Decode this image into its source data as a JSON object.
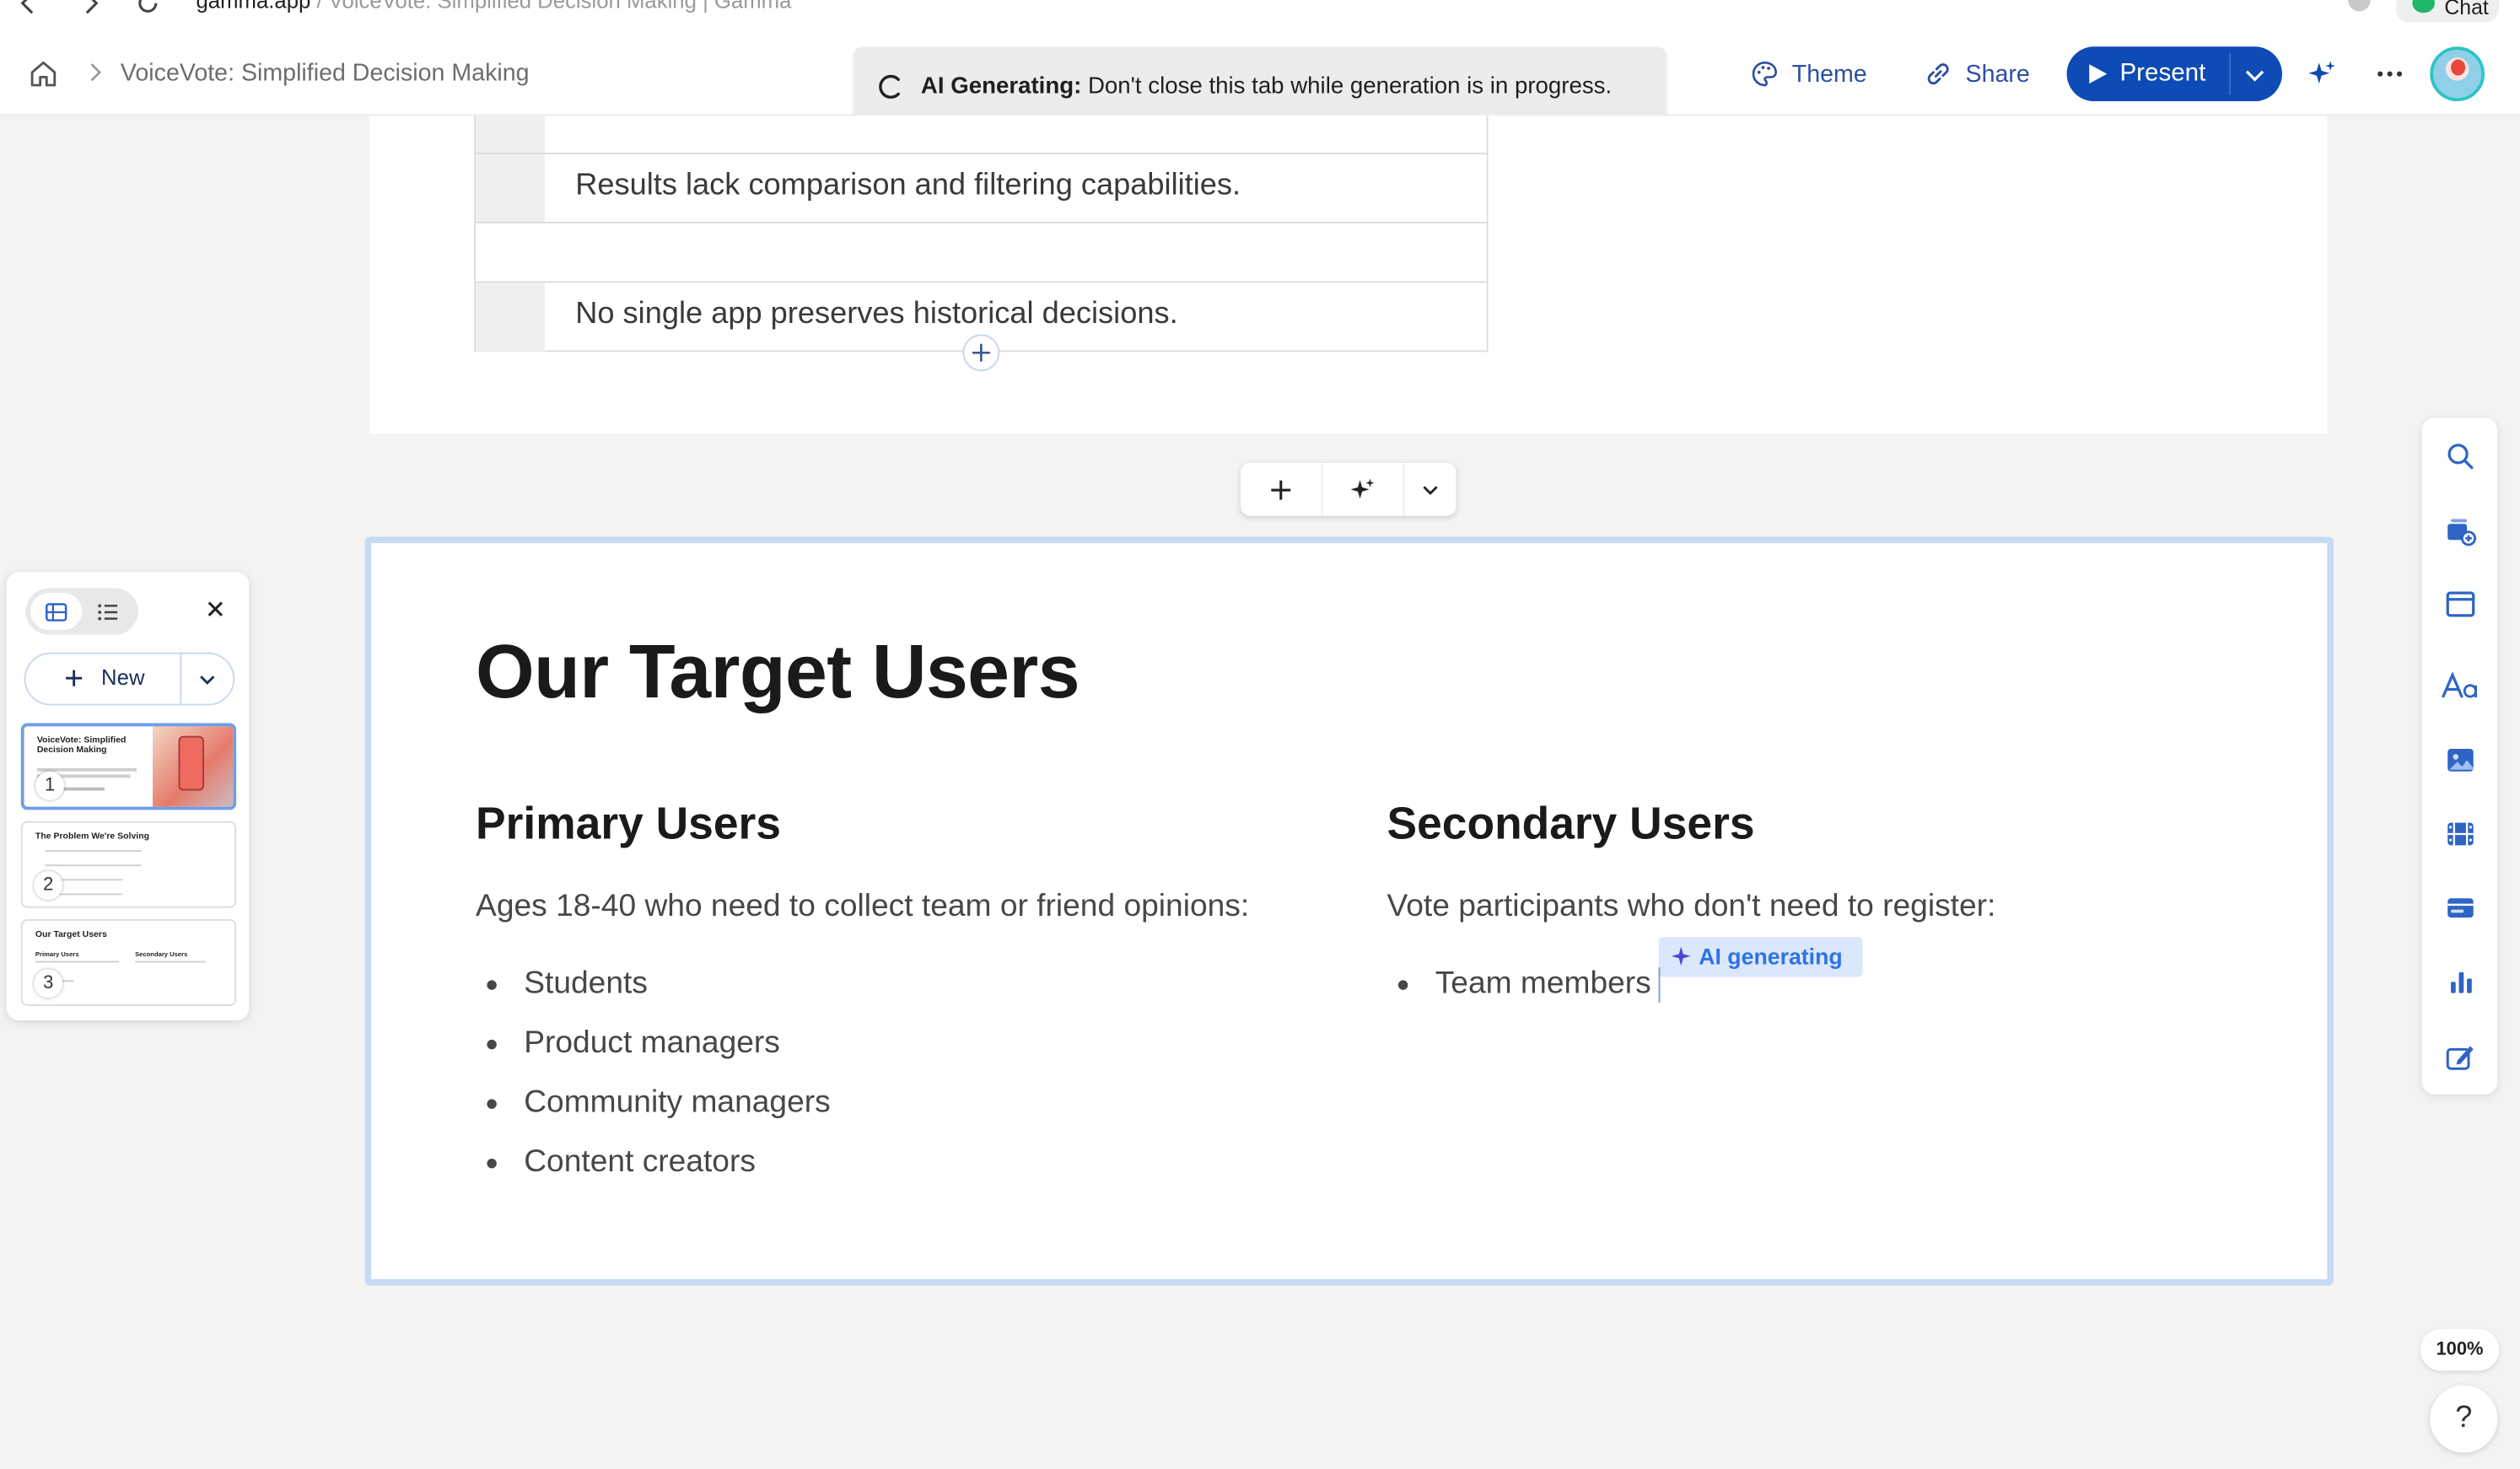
{
  "browser": {
    "url_host": "gamma.app",
    "url_rest": " / VoiceVote: Simplified Decision Making | Gamma",
    "chat_label": "Chat"
  },
  "topbar": {
    "doc_title": "VoiceVote: Simplified Decision Making",
    "ai_banner_bold": "AI Generating:",
    "ai_banner_text": " Don't close this tab while generation is in progress.",
    "theme_label": "Theme",
    "share_label": "Share",
    "present_label": "Present"
  },
  "previous_card": {
    "rows": [
      "",
      "Results lack comparison and filtering capabilities.",
      "",
      "No single app preserves historical decisions."
    ]
  },
  "current_card": {
    "title": "Our Target Users",
    "primary": {
      "heading": "Primary Users",
      "intro": "Ages 18-40 who need to collect team or friend opinions:",
      "items": [
        "Students",
        "Product managers",
        "Community managers",
        "Content creators"
      ]
    },
    "secondary": {
      "heading": "Secondary Users",
      "intro": "Vote participants who don't need to register:",
      "items": [
        "Team members"
      ]
    },
    "ai_tag": "AI generating"
  },
  "slide_panel": {
    "new_label": "New",
    "slides": [
      {
        "number": "1",
        "title": "VoiceVote: Simplified Decision Making"
      },
      {
        "number": "2",
        "title": "The Problem We're Solving"
      },
      {
        "number": "3",
        "title": "Our Target Users",
        "col1": "Primary Users",
        "col2": "Secondary Users"
      }
    ]
  },
  "status": {
    "zoom": "100%",
    "help": "?"
  },
  "colors": {
    "accent": "#0e4bb5",
    "card_border": "#c7daf4",
    "ai_tag_bg": "#dbe7fb",
    "ai_tag_text": "#2f73e4"
  },
  "icons": {
    "nav": [
      "back-icon",
      "forward-icon",
      "reload-icon",
      "home-icon",
      "chevron-right-icon"
    ],
    "toolbar": [
      "palette-icon",
      "link-icon",
      "play-icon",
      "chevron-down-icon",
      "sparkle-icon",
      "more-icon"
    ],
    "tools": [
      "search-icon",
      "add-card-icon",
      "layout-icon",
      "text-style-icon",
      "image-icon",
      "film-icon",
      "embed-icon",
      "chart-icon",
      "edit-icon"
    ]
  }
}
